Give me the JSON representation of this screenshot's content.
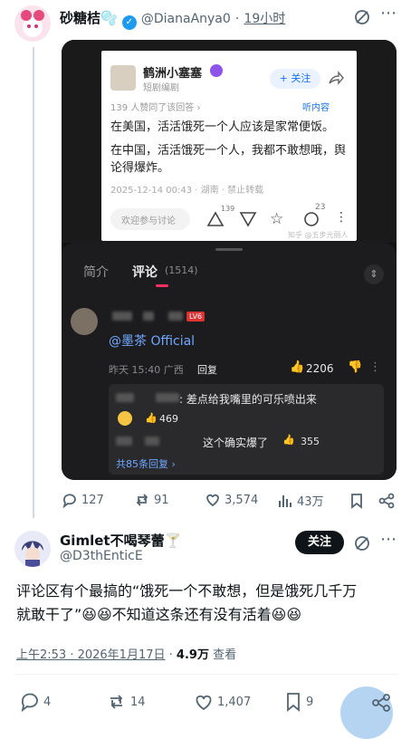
{
  "tweet1": {
    "display_name": "砂糖桔🫧",
    "handle": "@DianaAnya0",
    "time": "19小时",
    "media": {
      "card": {
        "account_name": "鹤洲小塞塞",
        "account_sub": "短剧编剧",
        "follow_label": "+ 关注",
        "likes_note": "139 人赞同了该回答 ›",
        "para1": "在美国，活活饿死一个人应该是家常便饭。",
        "para2": "在中国，活活饿死一个人，我都不敢想哦，舆论得爆炸。",
        "meta": "2025-12-14 00:43 · 湖南 · 禁止转载",
        "listen": "听内容",
        "discuss_placeholder": "欢迎参与讨论",
        "up_count": "139",
        "star_count": "23",
        "watermark": "知乎 @五步元丽人"
      },
      "tabs": {
        "intro": "简介",
        "comments": "评论",
        "comment_count": "(1514)"
      },
      "comment": {
        "badge": "LV6",
        "text": "@墨茶 Official",
        "meta": "昨天 15:40 广西",
        "reply_label": "回复",
        "like_count": "2206"
      },
      "replies": [
        {
          "text": ": 差点给我嘴里的可乐喷出来",
          "likes": "469"
        },
        {
          "text": "这个确实爆了",
          "likes": "355"
        }
      ],
      "more_replies": "共85条回复 ›"
    },
    "actions": {
      "replies": "127",
      "retweets": "91",
      "likes": "3,574",
      "views": "43万"
    }
  },
  "tweet2": {
    "display_name": "Gimlet不喝琴蕾🍸",
    "handle": "@D3thEnticE",
    "follow_label": "关注",
    "text_line1": "评论区有个最搞的“饿死一个不敢想，但是饿死几千万",
    "text_line2": "就敢干了”😆😆不知道这条还有没有活着😆😆",
    "timestamp": "上午2:53 · 2026年1月17日",
    "views_count": "4.9万",
    "views_label": "查看",
    "actions": {
      "replies": "4",
      "retweets": "14",
      "likes": "1,407",
      "bookmarks": "9"
    }
  }
}
